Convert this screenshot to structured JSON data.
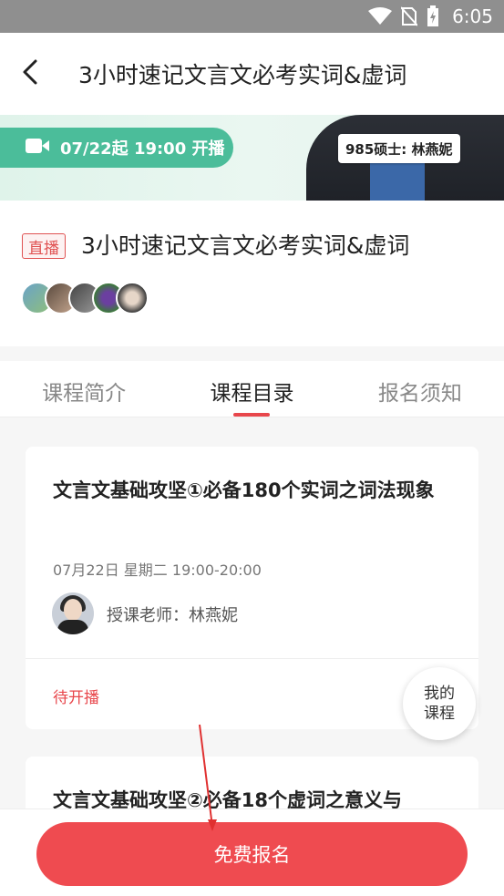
{
  "status_bar": {
    "time": "6:05",
    "icons": [
      "wifi-icon",
      "no-sim-icon",
      "battery-charging-icon"
    ]
  },
  "nav": {
    "title": "3小时速记文言文必考实词&虚词",
    "back_icon": "chevron-left-icon"
  },
  "banner": {
    "schedule": "07/22起 19:00 开播",
    "teacher_tag": "985硕士: 林燕妮",
    "accent": "#4bbd9a"
  },
  "course": {
    "badge": "直播",
    "title": "3小时速记文言文必考实词&虚词",
    "avatar_count": 5
  },
  "tabs": [
    {
      "label": "课程简介",
      "active": false
    },
    {
      "label": "课程目录",
      "active": true
    },
    {
      "label": "报名须知",
      "active": false
    }
  ],
  "lessons": [
    {
      "title": "文言文基础攻坚①必备180个实词之词法现象",
      "date": "07月22日 星期二 19:00-20:00",
      "teacher_label": "授课老师：林燕妮",
      "status": "待开播"
    },
    {
      "title": "文言文基础攻坚②必备18个虚词之意义与"
    }
  ],
  "floating": {
    "line1": "我的",
    "line2": "课程"
  },
  "bottom": {
    "enroll_label": "免费报名"
  },
  "colors": {
    "primary": "#ef4b50",
    "tab_indicator": "#e8474c"
  }
}
